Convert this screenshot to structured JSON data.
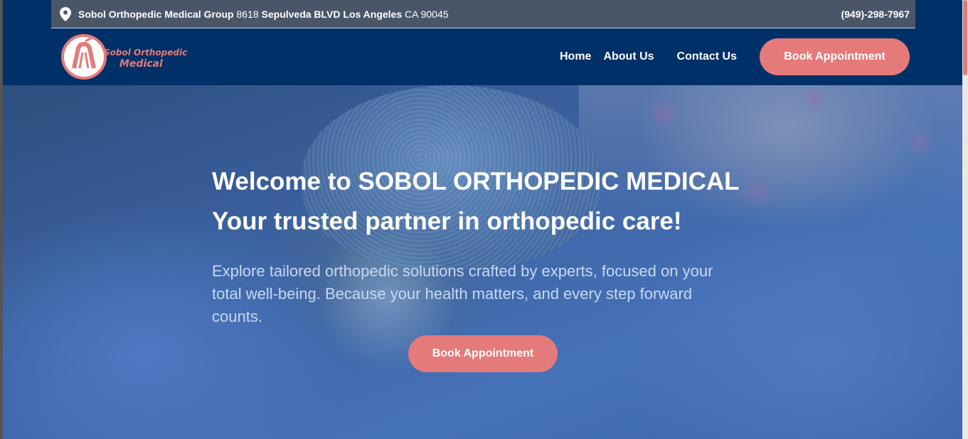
{
  "topbar": {
    "org": "Sobol Orthopedic Medical Group",
    "street_number": "8618",
    "street": "Sepulveda BLVD Los Angeles",
    "state_zip": "CA 90045",
    "phone": "(949)-298-7967",
    "icon": "location-pin-icon"
  },
  "logo": {
    "line1": "Sobol Orthopedic",
    "line2": "Medical"
  },
  "nav": {
    "home": "Home",
    "about": "About Us",
    "contact": "Contact Us",
    "cta": "Book Appointment"
  },
  "hero": {
    "title_line1": "Welcome to SOBOL ORTHOPEDIC MEDICAL",
    "title_line2": "Your trusted partner in orthopedic care!",
    "body": "Explore tailored orthopedic solutions crafted by experts, focused on your total well-being. Because your health matters, and every step forward counts.",
    "cta": "Book Appointment"
  },
  "colors": {
    "brand_navy": "#003068",
    "accent_coral": "#e57a7a",
    "topbar_gray": "#4a5668"
  }
}
